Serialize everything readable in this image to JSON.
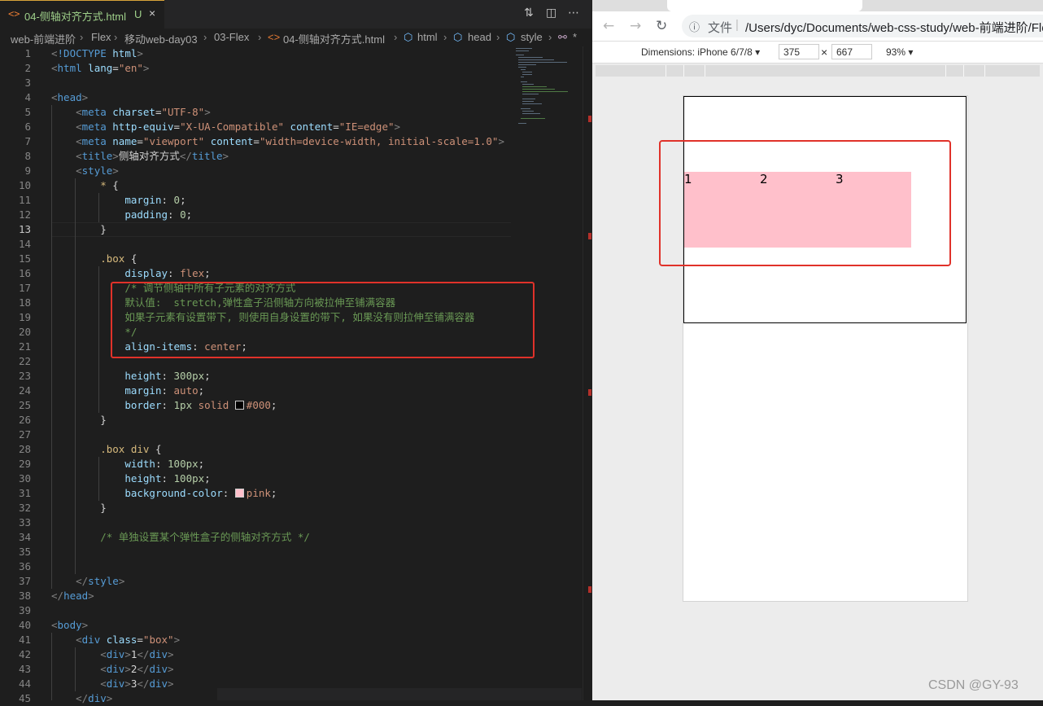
{
  "editor": {
    "tab": {
      "icon": "<>",
      "filename": "04-侧轴对齐方式.html",
      "modified": "U",
      "close": "×"
    },
    "breadcrumb": [
      {
        "label": "web-前端进阶"
      },
      {
        "label": "Flex"
      },
      {
        "label": "移动web-day03"
      },
      {
        "label": "03-Flex"
      },
      {
        "label": "04-侧轴对齐方式.html"
      },
      {
        "label": "html"
      },
      {
        "label": "head"
      },
      {
        "label": "style"
      },
      {
        "label": "*"
      }
    ],
    "current_line": 13,
    "lines": [
      {
        "n": 1,
        "t": [
          [
            "punc",
            "<"
          ],
          [
            "tag",
            "!DOCTYPE "
          ],
          [
            "attr",
            "html"
          ],
          [
            "punc",
            ">"
          ]
        ]
      },
      {
        "n": 2,
        "t": [
          [
            "punc",
            "<"
          ],
          [
            "tag",
            "html "
          ],
          [
            "attr",
            "lang"
          ],
          [
            "plain",
            "="
          ],
          [
            "str",
            "\"en\""
          ],
          [
            "punc",
            ">"
          ]
        ]
      },
      {
        "n": 3,
        "t": []
      },
      {
        "n": 4,
        "t": [
          [
            "punc",
            "<"
          ],
          [
            "tag",
            "head"
          ],
          [
            "punc",
            ">"
          ]
        ]
      },
      {
        "n": 5,
        "t": [
          [
            "plain",
            "    "
          ],
          [
            "punc",
            "<"
          ],
          [
            "tag",
            "meta "
          ],
          [
            "attr",
            "charset"
          ],
          [
            "plain",
            "="
          ],
          [
            "str",
            "\"UTF-8\""
          ],
          [
            "punc",
            ">"
          ]
        ]
      },
      {
        "n": 6,
        "t": [
          [
            "plain",
            "    "
          ],
          [
            "punc",
            "<"
          ],
          [
            "tag",
            "meta "
          ],
          [
            "attr",
            "http-equiv"
          ],
          [
            "plain",
            "="
          ],
          [
            "str",
            "\"X-UA-Compatible\" "
          ],
          [
            "attr",
            "content"
          ],
          [
            "plain",
            "="
          ],
          [
            "str",
            "\"IE=edge\""
          ],
          [
            "punc",
            ">"
          ]
        ]
      },
      {
        "n": 7,
        "t": [
          [
            "plain",
            "    "
          ],
          [
            "punc",
            "<"
          ],
          [
            "tag",
            "meta "
          ],
          [
            "attr",
            "name"
          ],
          [
            "plain",
            "="
          ],
          [
            "str",
            "\"viewport\" "
          ],
          [
            "attr",
            "content"
          ],
          [
            "plain",
            "="
          ],
          [
            "str",
            "\"width=device-width, initial-scale=1.0\""
          ],
          [
            "punc",
            ">"
          ]
        ]
      },
      {
        "n": 8,
        "t": [
          [
            "plain",
            "    "
          ],
          [
            "punc",
            "<"
          ],
          [
            "tag",
            "title"
          ],
          [
            "punc",
            ">"
          ],
          [
            "plain",
            "侧轴对齐方式"
          ],
          [
            "punc",
            "</"
          ],
          [
            "tag",
            "title"
          ],
          [
            "punc",
            ">"
          ]
        ]
      },
      {
        "n": 9,
        "t": [
          [
            "plain",
            "    "
          ],
          [
            "punc",
            "<"
          ],
          [
            "tag",
            "style"
          ],
          [
            "punc",
            ">"
          ]
        ]
      },
      {
        "n": 10,
        "t": [
          [
            "plain",
            "        "
          ],
          [
            "sel",
            "* "
          ],
          [
            "plain",
            "{"
          ]
        ]
      },
      {
        "n": 11,
        "t": [
          [
            "plain",
            "            "
          ],
          [
            "prop",
            "margin"
          ],
          [
            "plain",
            ": "
          ],
          [
            "num",
            "0"
          ],
          [
            "plain",
            ";"
          ]
        ]
      },
      {
        "n": 12,
        "t": [
          [
            "plain",
            "            "
          ],
          [
            "prop",
            "padding"
          ],
          [
            "plain",
            ": "
          ],
          [
            "num",
            "0"
          ],
          [
            "plain",
            ";"
          ]
        ]
      },
      {
        "n": 13,
        "t": [
          [
            "plain",
            "        }"
          ]
        ]
      },
      {
        "n": 14,
        "t": []
      },
      {
        "n": 15,
        "t": [
          [
            "plain",
            "        "
          ],
          [
            "sel",
            ".box "
          ],
          [
            "plain",
            "{"
          ]
        ]
      },
      {
        "n": 16,
        "t": [
          [
            "plain",
            "            "
          ],
          [
            "prop",
            "display"
          ],
          [
            "plain",
            ": "
          ],
          [
            "str",
            "flex"
          ],
          [
            "plain",
            ";"
          ]
        ]
      },
      {
        "n": 17,
        "t": [
          [
            "plain",
            "            "
          ],
          [
            "com",
            "/* 调节侧轴中所有子元素的对齐方式"
          ]
        ]
      },
      {
        "n": 18,
        "t": [
          [
            "plain",
            "            "
          ],
          [
            "com",
            "默认值:  stretch,弹性盒子沿侧轴方向被拉伸至铺满容器"
          ]
        ]
      },
      {
        "n": 19,
        "t": [
          [
            "plain",
            "            "
          ],
          [
            "com",
            "如果子元素有设置带下, 则使用自身设置的带下, 如果没有则拉伸至铺满容器"
          ]
        ]
      },
      {
        "n": 20,
        "t": [
          [
            "plain",
            "            "
          ],
          [
            "com",
            "*/"
          ]
        ]
      },
      {
        "n": 21,
        "t": [
          [
            "plain",
            "            "
          ],
          [
            "prop",
            "align-items"
          ],
          [
            "plain",
            ": "
          ],
          [
            "str",
            "center"
          ],
          [
            "plain",
            ";"
          ]
        ]
      },
      {
        "n": 22,
        "t": []
      },
      {
        "n": 23,
        "t": [
          [
            "plain",
            "            "
          ],
          [
            "prop",
            "height"
          ],
          [
            "plain",
            ": "
          ],
          [
            "num",
            "300px"
          ],
          [
            "plain",
            ";"
          ]
        ]
      },
      {
        "n": 24,
        "t": [
          [
            "plain",
            "            "
          ],
          [
            "prop",
            "margin"
          ],
          [
            "plain",
            ": "
          ],
          [
            "str",
            "auto"
          ],
          [
            "plain",
            ";"
          ]
        ]
      },
      {
        "n": 25,
        "t": [
          [
            "plain",
            "            "
          ],
          [
            "prop",
            "border"
          ],
          [
            "plain",
            ": "
          ],
          [
            "num",
            "1px "
          ],
          [
            "str",
            "solid "
          ],
          [
            "swatch",
            "#000000"
          ],
          [
            "str",
            "#000"
          ],
          [
            "plain",
            ";"
          ]
        ]
      },
      {
        "n": 26,
        "t": [
          [
            "plain",
            "        }"
          ]
        ]
      },
      {
        "n": 27,
        "t": []
      },
      {
        "n": 28,
        "t": [
          [
            "plain",
            "        "
          ],
          [
            "sel",
            ".box div "
          ],
          [
            "plain",
            "{"
          ]
        ]
      },
      {
        "n": 29,
        "t": [
          [
            "plain",
            "            "
          ],
          [
            "prop",
            "width"
          ],
          [
            "plain",
            ": "
          ],
          [
            "num",
            "100px"
          ],
          [
            "plain",
            ";"
          ]
        ]
      },
      {
        "n": 30,
        "t": [
          [
            "plain",
            "            "
          ],
          [
            "prop",
            "height"
          ],
          [
            "plain",
            ": "
          ],
          [
            "num",
            "100px"
          ],
          [
            "plain",
            ";"
          ]
        ]
      },
      {
        "n": 31,
        "t": [
          [
            "plain",
            "            "
          ],
          [
            "prop",
            "background-color"
          ],
          [
            "plain",
            ": "
          ],
          [
            "swatch",
            "#ffc0cb"
          ],
          [
            "str",
            "pink"
          ],
          [
            "plain",
            ";"
          ]
        ]
      },
      {
        "n": 32,
        "t": [
          [
            "plain",
            "        }"
          ]
        ]
      },
      {
        "n": 33,
        "t": []
      },
      {
        "n": 34,
        "t": [
          [
            "plain",
            "        "
          ],
          [
            "com",
            "/* 单独设置某个弹性盒子的侧轴对齐方式 */"
          ]
        ]
      },
      {
        "n": 35,
        "t": []
      },
      {
        "n": 36,
        "t": []
      },
      {
        "n": 37,
        "t": [
          [
            "plain",
            "    "
          ],
          [
            "punc",
            "</"
          ],
          [
            "tag",
            "style"
          ],
          [
            "punc",
            ">"
          ]
        ]
      },
      {
        "n": 38,
        "t": [
          [
            "punc",
            "</"
          ],
          [
            "tag",
            "head"
          ],
          [
            "punc",
            ">"
          ]
        ]
      },
      {
        "n": 39,
        "t": []
      },
      {
        "n": 40,
        "t": [
          [
            "punc",
            "<"
          ],
          [
            "tag",
            "body"
          ],
          [
            "punc",
            ">"
          ]
        ]
      },
      {
        "n": 41,
        "t": [
          [
            "plain",
            "    "
          ],
          [
            "punc",
            "<"
          ],
          [
            "tag",
            "div "
          ],
          [
            "attr",
            "class"
          ],
          [
            "plain",
            "="
          ],
          [
            "str",
            "\"box\""
          ],
          [
            "punc",
            ">"
          ]
        ]
      },
      {
        "n": 42,
        "t": [
          [
            "plain",
            "        "
          ],
          [
            "punc",
            "<"
          ],
          [
            "tag",
            "div"
          ],
          [
            "punc",
            ">"
          ],
          [
            "plain",
            "1"
          ],
          [
            "punc",
            "</"
          ],
          [
            "tag",
            "div"
          ],
          [
            "punc",
            ">"
          ]
        ]
      },
      {
        "n": 43,
        "t": [
          [
            "plain",
            "        "
          ],
          [
            "punc",
            "<"
          ],
          [
            "tag",
            "div"
          ],
          [
            "punc",
            ">"
          ],
          [
            "plain",
            "2"
          ],
          [
            "punc",
            "</"
          ],
          [
            "tag",
            "div"
          ],
          [
            "punc",
            ">"
          ]
        ]
      },
      {
        "n": 44,
        "t": [
          [
            "plain",
            "        "
          ],
          [
            "punc",
            "<"
          ],
          [
            "tag",
            "div"
          ],
          [
            "punc",
            ">"
          ],
          [
            "plain",
            "3"
          ],
          [
            "punc",
            "</"
          ],
          [
            "tag",
            "div"
          ],
          [
            "punc",
            ">"
          ]
        ]
      },
      {
        "n": 45,
        "t": [
          [
            "plain",
            "    "
          ],
          [
            "punc",
            "</"
          ],
          [
            "tag",
            "div"
          ],
          [
            "punc",
            ">"
          ]
        ]
      }
    ]
  },
  "browser": {
    "address": {
      "file_label": "文件",
      "url": "/Users/dyc/Documents/web-css-study/web-前端进阶/Fle"
    },
    "devtools": {
      "device": "Dimensions: iPhone 6/7/8 ▾",
      "width": "375",
      "height": "667",
      "zoom": "93% ▾"
    },
    "preview_items": [
      "1",
      "2",
      "3"
    ]
  },
  "watermark": "CSDN @GY-93",
  "colors": {
    "annotation": "#e0322a",
    "item_bg": "#ffc0cb",
    "tab_text": "#9fd08a"
  }
}
